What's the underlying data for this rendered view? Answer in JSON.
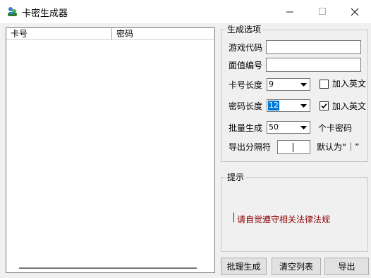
{
  "window": {
    "title": "卡密生成器"
  },
  "list": {
    "columns": [
      "卡号",
      "密码"
    ]
  },
  "options": {
    "group_title": "生成选项",
    "game_code_label": "游戏代码",
    "game_code_value": "",
    "face_value_label": "面值编号",
    "face_value_value": "",
    "card_length_label": "卡号长度",
    "card_length_value": "9",
    "card_add_english_label": "加入英文",
    "card_add_english_checked": false,
    "pwd_length_label": "密码长度",
    "pwd_length_value": "12",
    "pwd_add_english_label": "加入英文",
    "pwd_add_english_checked": true,
    "batch_label": "批量生成",
    "batch_value": "50",
    "batch_suffix": "个卡密码",
    "separator_label": "导出分隔符",
    "separator_value": "",
    "separator_default": "默认为“｜”"
  },
  "hint": {
    "group_title": "提示",
    "text": "请自觉遵守相关法律法规"
  },
  "buttons": {
    "generate": "批理生成",
    "clear": "清空列表",
    "export": "导出"
  }
}
